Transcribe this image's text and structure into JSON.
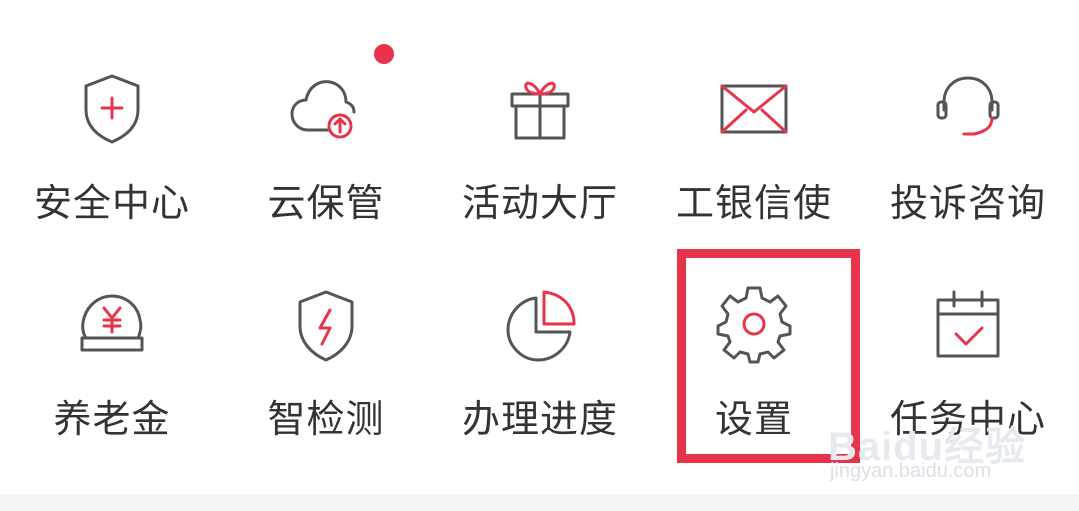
{
  "menu": {
    "items": [
      {
        "label": "安全中心",
        "icon": "shield-plus-icon"
      },
      {
        "label": "云保管",
        "icon": "cloud-upload-icon",
        "has_red_dot": true
      },
      {
        "label": "活动大厅",
        "icon": "gift-icon"
      },
      {
        "label": "工银信使",
        "icon": "envelope-icon"
      },
      {
        "label": "投诉咨询",
        "icon": "headset-icon"
      },
      {
        "label": "养老金",
        "icon": "yuan-coin-icon"
      },
      {
        "label": "智检测",
        "icon": "shield-bolt-icon"
      },
      {
        "label": "办理进度",
        "icon": "pie-progress-icon"
      },
      {
        "label": "设置",
        "icon": "gear-icon",
        "highlighted": true
      },
      {
        "label": "任务中心",
        "icon": "calendar-check-icon"
      }
    ]
  },
  "colors": {
    "accent": "#e8344a",
    "icon_stroke": "#555555",
    "text": "#333333"
  },
  "watermark": {
    "main": "Baidu经验",
    "sub": "jingyan.baidu.com"
  }
}
